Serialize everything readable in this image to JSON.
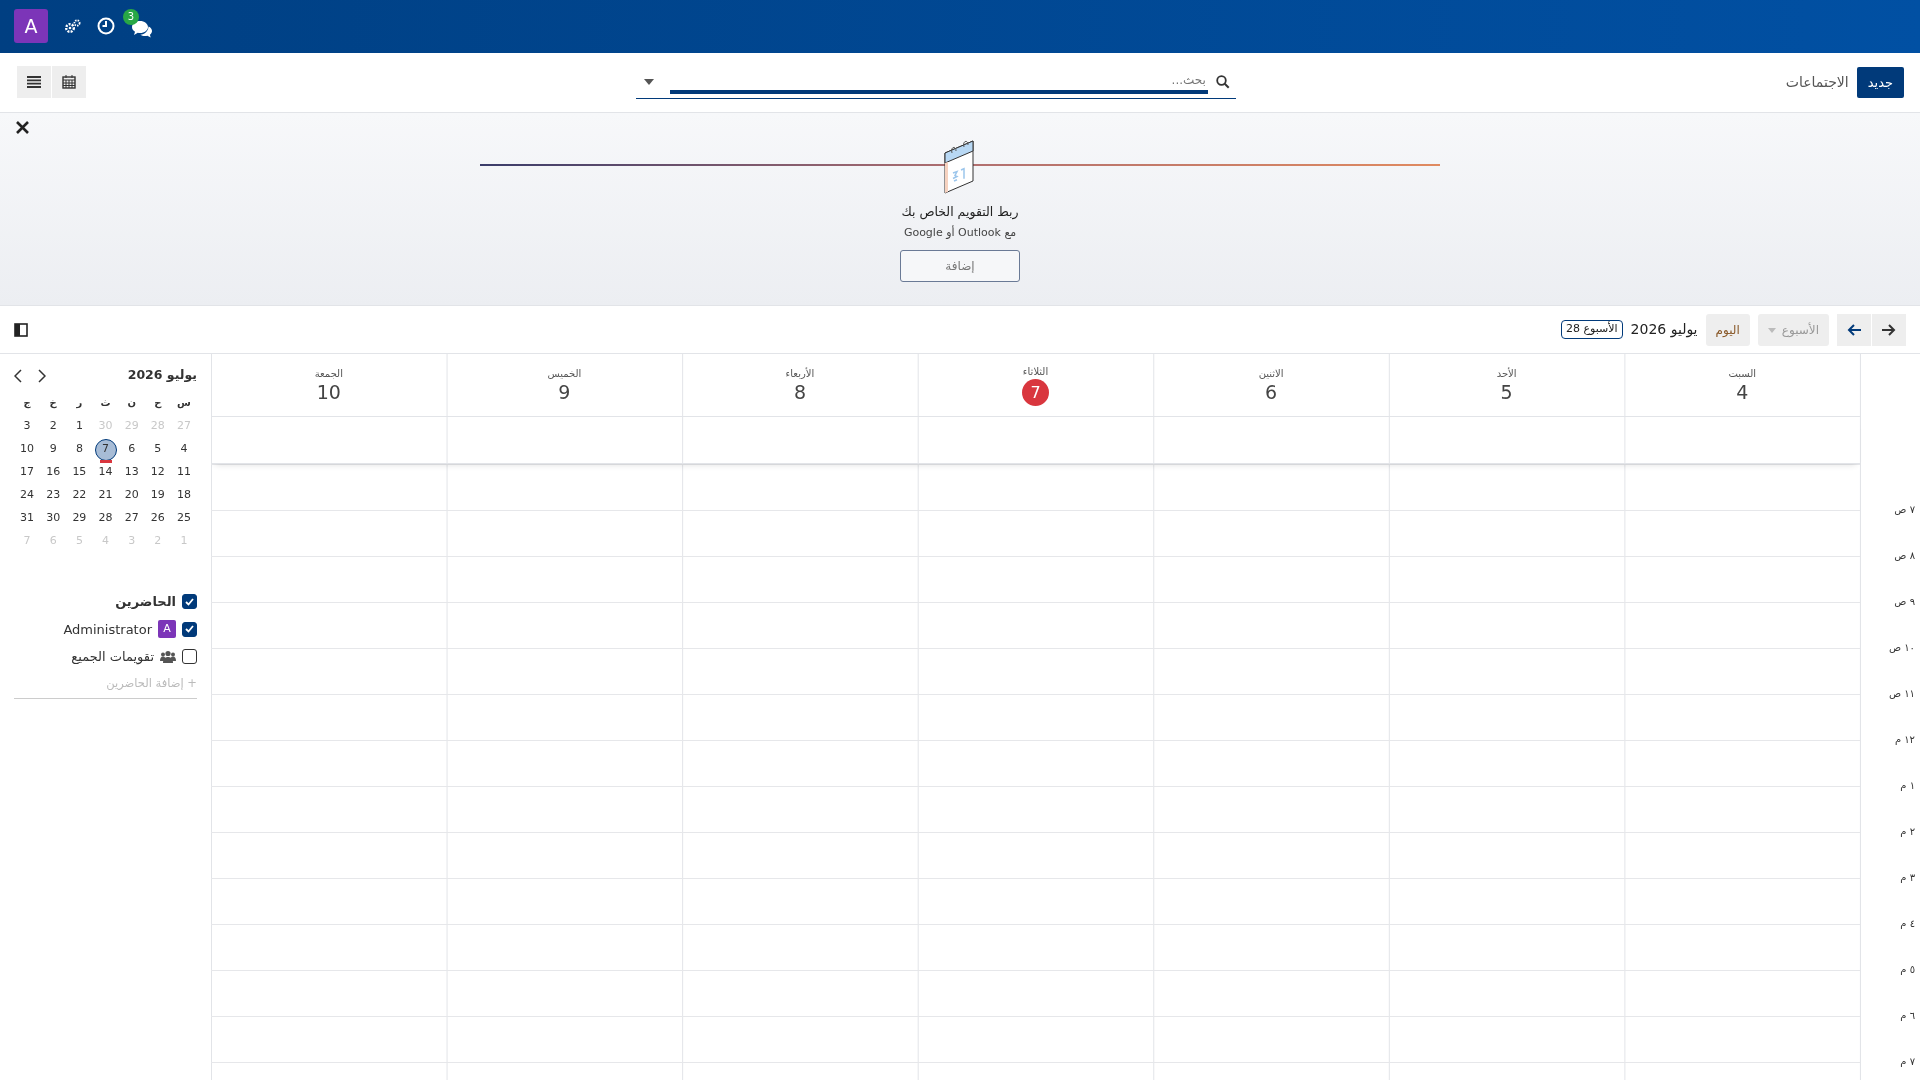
{
  "navbar": {
    "avatar": "A",
    "messages_badge": "3"
  },
  "control_panel": {
    "new_button": "جديد",
    "breadcrumb": "الاجتماعات",
    "search": {
      "placeholder": "بحث..."
    }
  },
  "banner": {
    "title": "ربط التقويم الخاص بك",
    "subtitle": "مع Outlook أو Google",
    "button": "إضافة"
  },
  "toolbar": {
    "scale": {
      "label": "الأسبوع",
      "disabled": true
    },
    "today": "اليوم",
    "title": "يوليو 2026",
    "week_badge": "الأسبوع 28"
  },
  "days": [
    {
      "weekday": "السبت",
      "date": "4",
      "today": false
    },
    {
      "weekday": "الأحد",
      "date": "5",
      "today": false
    },
    {
      "weekday": "الاثنين",
      "date": "6",
      "today": false
    },
    {
      "weekday": "الثلاثاء",
      "date": "7",
      "today": true
    },
    {
      "weekday": "الأربعاء",
      "date": "8",
      "today": false
    },
    {
      "weekday": "الخميس",
      "date": "9",
      "today": false
    },
    {
      "weekday": "الجمعة",
      "date": "10",
      "today": false
    }
  ],
  "hours": [
    "٧ ص",
    "٨ ص",
    "٩ ص",
    "١٠ ص",
    "١١ ص",
    "١٢ م",
    "١ م",
    "٢ م",
    "٣ م",
    "٤ م",
    "٥ م",
    "٦ م",
    "٧ م"
  ],
  "mini_calendar": {
    "title": "يوليو 2026",
    "weekdays": [
      "س",
      "ح",
      "ن",
      "ث",
      "ر",
      "خ",
      "ج"
    ],
    "weeks": [
      [
        {
          "d": "27",
          "muted": true,
          "selected": false,
          "today": false
        },
        {
          "d": "28",
          "muted": true,
          "selected": false,
          "today": false
        },
        {
          "d": "29",
          "muted": true,
          "selected": false,
          "today": false
        },
        {
          "d": "30",
          "muted": true,
          "selected": false,
          "today": false
        },
        {
          "d": "1",
          "muted": false,
          "selected": false,
          "today": false
        },
        {
          "d": "2",
          "muted": false,
          "selected": false,
          "today": false
        },
        {
          "d": "3",
          "muted": false,
          "selected": false,
          "today": false
        }
      ],
      [
        {
          "d": "4",
          "muted": false,
          "selected": false,
          "today": false
        },
        {
          "d": "5",
          "muted": false,
          "selected": false,
          "today": false
        },
        {
          "d": "6",
          "muted": false,
          "selected": false,
          "today": false
        },
        {
          "d": "7",
          "muted": false,
          "selected": true,
          "today": true
        },
        {
          "d": "8",
          "muted": false,
          "selected": false,
          "today": false
        },
        {
          "d": "9",
          "muted": false,
          "selected": false,
          "today": false
        },
        {
          "d": "10",
          "muted": false,
          "selected": false,
          "today": false
        }
      ],
      [
        {
          "d": "11",
          "muted": false,
          "selected": false,
          "today": false
        },
        {
          "d": "12",
          "muted": false,
          "selected": false,
          "today": false
        },
        {
          "d": "13",
          "muted": false,
          "selected": false,
          "today": false
        },
        {
          "d": "14",
          "muted": false,
          "selected": false,
          "today": false
        },
        {
          "d": "15",
          "muted": false,
          "selected": false,
          "today": false
        },
        {
          "d": "16",
          "muted": false,
          "selected": false,
          "today": false
        },
        {
          "d": "17",
          "muted": false,
          "selected": false,
          "today": false
        }
      ],
      [
        {
          "d": "18",
          "muted": false,
          "selected": false,
          "today": false
        },
        {
          "d": "19",
          "muted": false,
          "selected": false,
          "today": false
        },
        {
          "d": "20",
          "muted": false,
          "selected": false,
          "today": false
        },
        {
          "d": "21",
          "muted": false,
          "selected": false,
          "today": false
        },
        {
          "d": "22",
          "muted": false,
          "selected": false,
          "today": false
        },
        {
          "d": "23",
          "muted": false,
          "selected": false,
          "today": false
        },
        {
          "d": "24",
          "muted": false,
          "selected": false,
          "today": false
        }
      ],
      [
        {
          "d": "25",
          "muted": false,
          "selected": false,
          "today": false
        },
        {
          "d": "26",
          "muted": false,
          "selected": false,
          "today": false
        },
        {
          "d": "27",
          "muted": false,
          "selected": false,
          "today": false
        },
        {
          "d": "28",
          "muted": false,
          "selected": false,
          "today": false
        },
        {
          "d": "29",
          "muted": false,
          "selected": false,
          "today": false
        },
        {
          "d": "30",
          "muted": false,
          "selected": false,
          "today": false
        },
        {
          "d": "31",
          "muted": false,
          "selected": false,
          "today": false
        }
      ],
      [
        {
          "d": "1",
          "muted": true,
          "selected": false,
          "today": false
        },
        {
          "d": "2",
          "muted": true,
          "selected": false,
          "today": false
        },
        {
          "d": "3",
          "muted": true,
          "selected": false,
          "today": false
        },
        {
          "d": "4",
          "muted": true,
          "selected": false,
          "today": false
        },
        {
          "d": "5",
          "muted": true,
          "selected": false,
          "today": false
        },
        {
          "d": "6",
          "muted": true,
          "selected": false,
          "today": false
        },
        {
          "d": "7",
          "muted": true,
          "selected": false,
          "today": false
        }
      ]
    ]
  },
  "filters": [
    {
      "kind": "group",
      "label": "الحاضرين",
      "checked": true
    },
    {
      "kind": "user",
      "label": "Administrator",
      "avatar": "A",
      "checked": true
    },
    {
      "kind": "everyone",
      "label": "تقويمات الجميع",
      "checked": false
    }
  ],
  "add_attendees": "+ إضافة الحاضرين"
}
